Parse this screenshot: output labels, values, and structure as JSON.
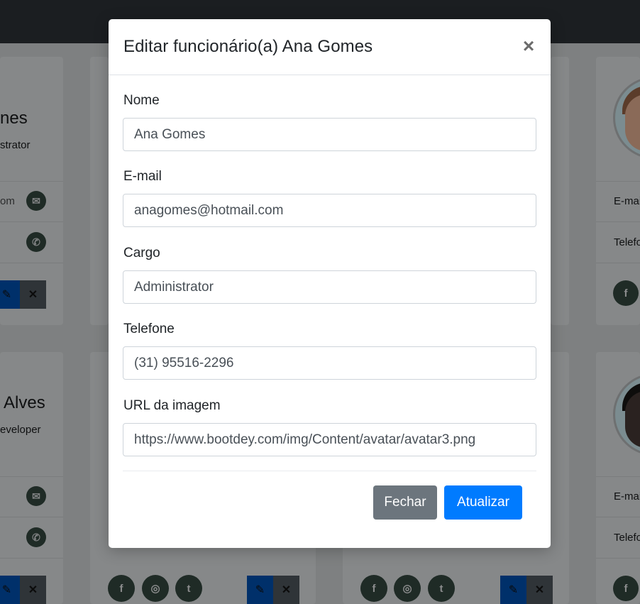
{
  "modal": {
    "title": "Editar funcionário(a) Ana Gomes",
    "close_symbol": "×",
    "fields": [
      {
        "label": "Nome",
        "value": "Ana Gomes"
      },
      {
        "label": "E-mail",
        "value": "anagomes@hotmail.com"
      },
      {
        "label": "Cargo",
        "value": "Administrator"
      },
      {
        "label": "Telefone",
        "value": "(31) 95516-2296"
      },
      {
        "label": "URL da imagem",
        "value": "https://www.bootdey.com/img/Content/avatar/avatar3.png"
      }
    ],
    "buttons": {
      "close_label": "Fechar",
      "update_label": "Atualizar"
    }
  },
  "background": {
    "card1": {
      "name_fragment": "nes",
      "role_fragment": "strator",
      "email_fragment": "om"
    },
    "card2": {
      "name_fragment": "Alves",
      "role_fragment": "eveloper"
    },
    "card_right": {
      "email_label": "E-mai",
      "phone_label": "Telefo"
    }
  },
  "icons": {
    "email": "envelope-icon",
    "phone": "phone-icon",
    "edit": "pencil-icon",
    "delete": "x-icon",
    "facebook": "facebook-icon",
    "instagram": "instagram-icon",
    "twitter": "twitter-icon",
    "close": "close-icon"
  },
  "colors": {
    "primary": "#007bff",
    "secondary": "#6c757d",
    "navbar": "#343a40"
  }
}
